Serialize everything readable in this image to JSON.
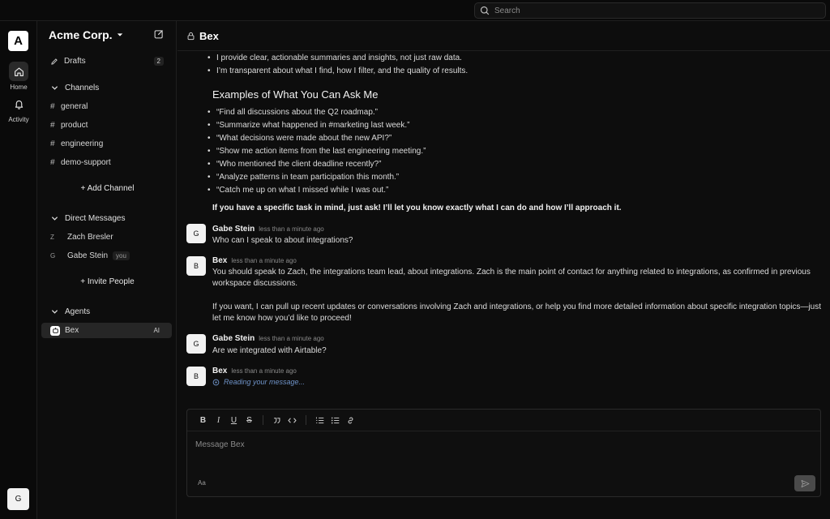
{
  "search": {
    "placeholder": "Search"
  },
  "rail": {
    "workspace_initial": "A",
    "items": [
      {
        "label": "Home",
        "icon": "home-icon"
      },
      {
        "label": "Activity",
        "icon": "bell-icon"
      }
    ],
    "user_initial": "G"
  },
  "sidebar": {
    "workspace_name": "Acme Corp.",
    "drafts": {
      "label": "Drafts",
      "count": "2"
    },
    "channels_header": "Channels",
    "channels": [
      "general",
      "product",
      "engineering",
      "demo-support"
    ],
    "add_channel": "+ Add Channel",
    "dm_header": "Direct Messages",
    "dms": [
      {
        "initial": "Z",
        "name": "Zach Bresler",
        "tag": ""
      },
      {
        "initial": "G",
        "name": "Gabe Stein",
        "tag": "you"
      }
    ],
    "invite": "+ Invite People",
    "agents_header": "Agents",
    "agents": [
      {
        "name": "Bex",
        "tag": "AI"
      }
    ]
  },
  "channel": {
    "title": "Bex"
  },
  "conversation": {
    "top_bullets": [
      "I provide clear, actionable summaries and insights, not just raw data.",
      "I’m transparent about what I find, how I filter, and the quality of results."
    ],
    "examples_heading": "Examples of What You Can Ask Me",
    "examples": [
      "“Find all discussions about the Q2 roadmap.”",
      "“Summarize what happened in #marketing last week.”",
      "“What decisions were made about the new API?”",
      "“Show me action items from the last engineering meeting.”",
      "“Who mentioned the client deadline recently?”",
      "“Analyze patterns in team participation this month.”",
      "“Catch me up on what I missed while I was out.”"
    ],
    "closing": "If you have a specific task in mind, just ask! I’ll let you know exactly what I can do and how I’ll approach it.",
    "messages": [
      {
        "initial": "G",
        "author": "Gabe Stein",
        "time": "less than a minute ago",
        "text": "Who can I speak to about integrations?"
      },
      {
        "initial": "B",
        "author": "Bex",
        "time": "less than a minute ago",
        "text1": "You should speak to Zach, the integrations team lead, about integrations. Zach is the main point of contact for anything related to integrations, as confirmed in previous workspace discussions.",
        "text2": "If you want, I can pull up recent updates or conversations involving Zach and integrations, or help you find more detailed information about specific integration topics—just let me know how you’d like to proceed!"
      },
      {
        "initial": "G",
        "author": "Gabe Stein",
        "time": "less than a minute ago",
        "text": "Are we integrated with Airtable?"
      },
      {
        "initial": "B",
        "author": "Bex",
        "time": "less than a minute ago",
        "status": "Reading your message..."
      }
    ]
  },
  "composer": {
    "placeholder": "Message Bex",
    "toolbar": [
      "B",
      "I",
      "U",
      "S"
    ],
    "format_toggle": "Aa"
  }
}
